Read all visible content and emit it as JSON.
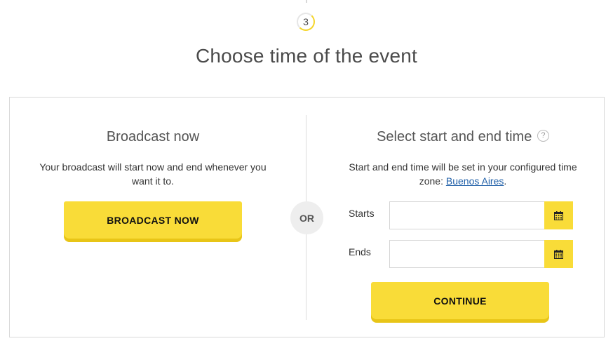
{
  "step": {
    "number": "3"
  },
  "title": "Choose time of the event",
  "broadcast_now": {
    "heading": "Broadcast now",
    "description": "Your broadcast will start now and end whenever you want it to.",
    "button_label": "BROADCAST NOW"
  },
  "separator": {
    "label": "OR"
  },
  "schedule": {
    "heading": "Select start and end time",
    "help_icon": "?",
    "description_prefix": "Start and end time will be set in your configured time zone: ",
    "timezone_link": "Buenos Aires",
    "description_suffix": ".",
    "starts_label": "Starts",
    "starts_value": "",
    "ends_label": "Ends",
    "ends_value": "",
    "calendar_icon": "calendar-icon",
    "button_label": "CONTINUE"
  },
  "colors": {
    "accent": "#f9dc38",
    "link": "#1f5fa8"
  }
}
